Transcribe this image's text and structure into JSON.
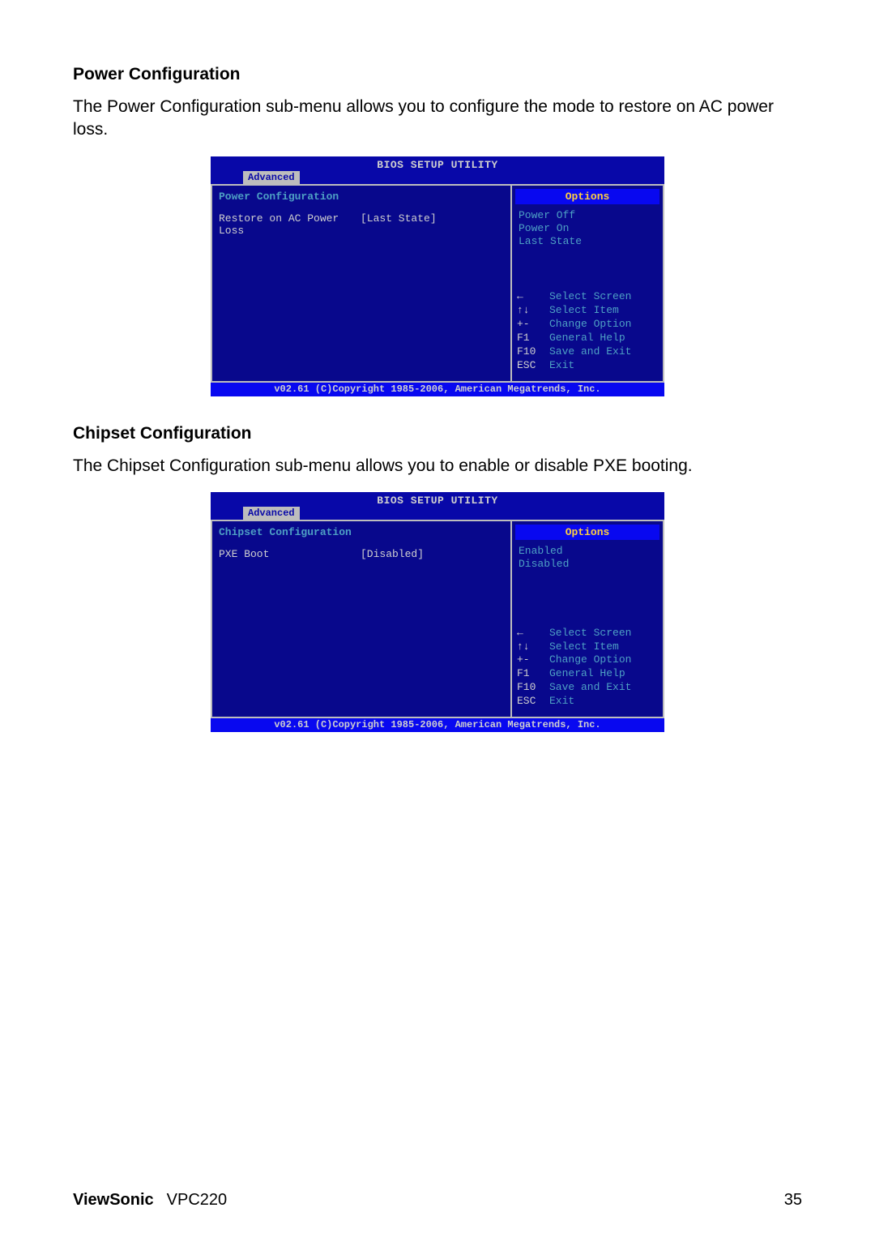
{
  "sections": [
    {
      "heading": "Power Configuration",
      "desc": "The Power Configuration sub-menu allows you to configure the mode to restore on AC power loss.",
      "bios": {
        "title": "BIOS SETUP UTILITY",
        "tab": "Advanced",
        "left_title": "Power Configuration",
        "item_label": "Restore on AC Power Loss",
        "item_value": "[Last State]",
        "options_header": "Options",
        "options": [
          "Power Off",
          "Power On",
          "Last State"
        ],
        "keys": [
          {
            "k": "←",
            "l": "Select Screen"
          },
          {
            "k": "↑↓",
            "l": "Select Item"
          },
          {
            "k": "+-",
            "l": "Change Option"
          },
          {
            "k": "F1",
            "l": "General Help"
          },
          {
            "k": "F10",
            "l": "Save and Exit"
          },
          {
            "k": "ESC",
            "l": "Exit"
          }
        ],
        "footer": "v02.61 (C)Copyright 1985-2006, American Megatrends, Inc."
      }
    },
    {
      "heading": "Chipset Configuration",
      "desc": "The Chipset Configuration sub-menu allows you to enable or disable PXE booting.",
      "bios": {
        "title": "BIOS SETUP UTILITY",
        "tab": "Advanced",
        "left_title": "Chipset Configuration",
        "item_label": "PXE Boot",
        "item_value": "[Disabled]",
        "options_header": "Options",
        "options": [
          "Enabled",
          "Disabled"
        ],
        "keys": [
          {
            "k": "←",
            "l": "Select Screen"
          },
          {
            "k": "↑↓",
            "l": "Select Item"
          },
          {
            "k": "+-",
            "l": "Change Option"
          },
          {
            "k": "F1",
            "l": "General Help"
          },
          {
            "k": "F10",
            "l": "Save and Exit"
          },
          {
            "k": "ESC",
            "l": "Exit"
          }
        ],
        "footer": "v02.61 (C)Copyright 1985-2006, American Megatrends, Inc."
      }
    }
  ],
  "page_footer": {
    "brand": "ViewSonic",
    "model": "VPC220",
    "page_number": "35"
  }
}
